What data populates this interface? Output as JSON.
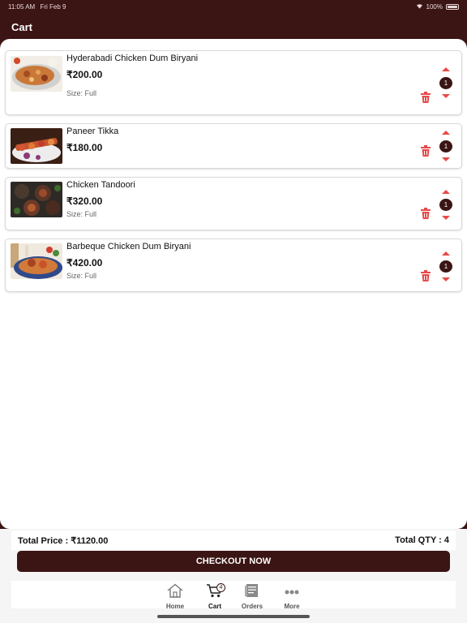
{
  "status": {
    "time": "11:05 AM",
    "date": "Fri Feb 9",
    "battery": "100%"
  },
  "header": {
    "title": "Cart"
  },
  "items": [
    {
      "name": "Hyderabadi Chicken Dum Biryani",
      "price": "₹200.00",
      "size": "Size: Full",
      "qty": "1"
    },
    {
      "name": "Paneer Tikka",
      "price": "₹180.00",
      "size": "",
      "qty": "1"
    },
    {
      "name": "Chicken Tandoori",
      "price": "₹320.00",
      "size": "Size: Full",
      "qty": "1"
    },
    {
      "name": "Barbeque Chicken Dum Biryani",
      "price": "₹420.00",
      "size": "Size: Full",
      "qty": "1"
    }
  ],
  "summary": {
    "total_price": "Total Price : ₹1120.00",
    "total_qty": "Total QTY : 4"
  },
  "checkout": {
    "label": "CHECKOUT NOW"
  },
  "tabs": [
    {
      "label": "Home",
      "icon": "home-icon"
    },
    {
      "label": "Cart",
      "icon": "cart-icon",
      "badge": "4"
    },
    {
      "label": "Orders",
      "icon": "orders-icon"
    },
    {
      "label": "More",
      "icon": "more-icon"
    }
  ],
  "colors": {
    "brand": "#3b1414",
    "accent": "#e84a4a",
    "background": "#ffffff"
  }
}
